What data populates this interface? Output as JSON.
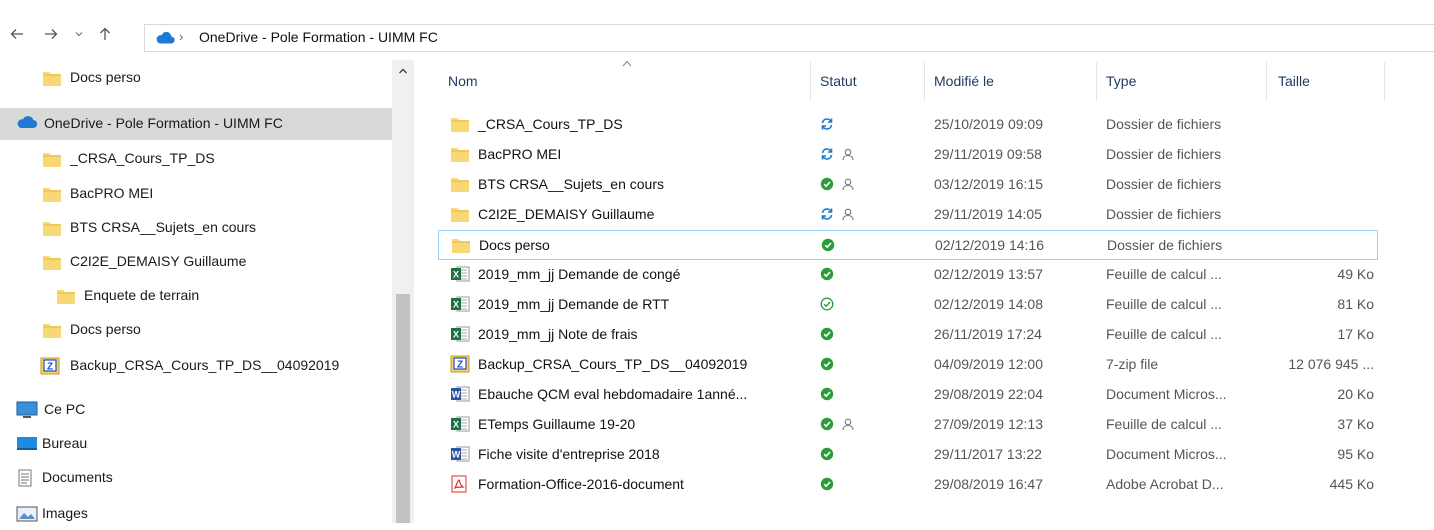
{
  "address": {
    "back_icon": "arrow-left-icon",
    "forward_icon": "arrow-right-icon",
    "recent_icon": "chevron-down-icon",
    "up_icon": "arrow-up-icon",
    "separator": "›",
    "path": "OneDrive - Pole Formation - UIMM FC"
  },
  "sidebar": {
    "items": [
      {
        "label": "Docs perso",
        "icon": "folder-icon",
        "indent": 1
      },
      {
        "label": "OneDrive - Pole Formation - UIMM FC",
        "icon": "cloud-icon",
        "indent": 0,
        "selected": true
      },
      {
        "label": "_CRSA_Cours_TP_DS",
        "icon": "folder-icon",
        "indent": 1
      },
      {
        "label": "BacPRO MEI",
        "icon": "folder-icon",
        "indent": 1
      },
      {
        "label": "BTS CRSA__Sujets_en cours",
        "icon": "folder-icon",
        "indent": 1
      },
      {
        "label": "C2I2E_DEMAISY Guillaume",
        "icon": "folder-icon",
        "indent": 1
      },
      {
        "label": "Enquete de terrain",
        "icon": "folder-icon",
        "indent": 2
      },
      {
        "label": "Docs perso",
        "icon": "folder-icon",
        "indent": 1
      },
      {
        "label": "Backup_CRSA_Cours_TP_DS__04092019",
        "icon": "zip-icon",
        "indent": 1
      },
      {
        "label": "Ce PC",
        "icon": "pc-icon",
        "indent": 0
      },
      {
        "label": "Bureau",
        "icon": "desktop-icon",
        "indent": 1
      },
      {
        "label": "Documents",
        "icon": "documents-icon",
        "indent": 1
      },
      {
        "label": "Images",
        "icon": "images-icon",
        "indent": 1
      }
    ]
  },
  "columns": {
    "name": "Nom",
    "status": "Statut",
    "modified": "Modifié le",
    "type": "Type",
    "size": "Taille"
  },
  "files": [
    {
      "name": "_CRSA_Cours_TP_DS",
      "icon": "folder-icon",
      "status": "sync",
      "shared": false,
      "modified": "25/10/2019 09:09",
      "type": "Dossier de fichiers",
      "size": ""
    },
    {
      "name": "BacPRO MEI",
      "icon": "folder-icon",
      "status": "sync",
      "shared": true,
      "modified": "29/11/2019 09:58",
      "type": "Dossier de fichiers",
      "size": ""
    },
    {
      "name": "BTS CRSA__Sujets_en cours",
      "icon": "folder-icon",
      "status": "available",
      "shared": true,
      "modified": "03/12/2019 16:15",
      "type": "Dossier de fichiers",
      "size": ""
    },
    {
      "name": "C2I2E_DEMAISY Guillaume",
      "icon": "folder-icon",
      "status": "sync",
      "shared": true,
      "modified": "29/11/2019 14:05",
      "type": "Dossier de fichiers",
      "size": ""
    },
    {
      "name": "Docs perso",
      "icon": "folder-icon",
      "status": "available",
      "shared": false,
      "modified": "02/12/2019 14:16",
      "type": "Dossier de fichiers",
      "size": "",
      "focused": true
    },
    {
      "name": "2019_mm_jj Demande de congé",
      "icon": "excel-icon",
      "status": "available",
      "shared": false,
      "modified": "02/12/2019 13:57",
      "type": "Feuille de calcul ...",
      "size": "49 Ko"
    },
    {
      "name": "2019_mm_jj Demande de RTT",
      "icon": "excel-icon",
      "status": "online",
      "shared": false,
      "modified": "02/12/2019 14:08",
      "type": "Feuille de calcul ...",
      "size": "81 Ko"
    },
    {
      "name": "2019_mm_jj Note de frais",
      "icon": "excel-icon",
      "status": "available",
      "shared": false,
      "modified": "26/11/2019 17:24",
      "type": "Feuille de calcul ...",
      "size": "17 Ko"
    },
    {
      "name": "Backup_CRSA_Cours_TP_DS__04092019",
      "icon": "zip-icon",
      "status": "available",
      "shared": false,
      "modified": "04/09/2019 12:00",
      "type": "7-zip file",
      "size": "12 076 945 ..."
    },
    {
      "name": "Ebauche QCM eval hebdomadaire 1anné...",
      "icon": "word-icon",
      "status": "available",
      "shared": false,
      "modified": "29/08/2019 22:04",
      "type": "Document Micros...",
      "size": "20 Ko"
    },
    {
      "name": "ETemps Guillaume 19-20",
      "icon": "excel-icon",
      "status": "available",
      "shared": true,
      "modified": "27/09/2019 12:13",
      "type": "Feuille de calcul ...",
      "size": "37 Ko"
    },
    {
      "name": "Fiche visite d'entreprise 2018",
      "icon": "word-icon",
      "status": "available",
      "shared": false,
      "modified": "29/11/2017 13:22",
      "type": "Document Micros...",
      "size": "95 Ko"
    },
    {
      "name": "Formation-Office-2016-document",
      "icon": "pdf-icon",
      "status": "available",
      "shared": false,
      "modified": "29/08/2019 16:47",
      "type": "Adobe Acrobat D...",
      "size": "445 Ko"
    }
  ],
  "colors": {
    "folder": "#f8d775",
    "folder_dark": "#e8b84a",
    "cloud": "#1f78d1",
    "ok_green": "#2a9d3a",
    "sync_blue": "#1f78d1",
    "excel": "#1e7145",
    "word": "#2b579a",
    "pdf": "#d93025",
    "zip": "#1a4fd1"
  }
}
